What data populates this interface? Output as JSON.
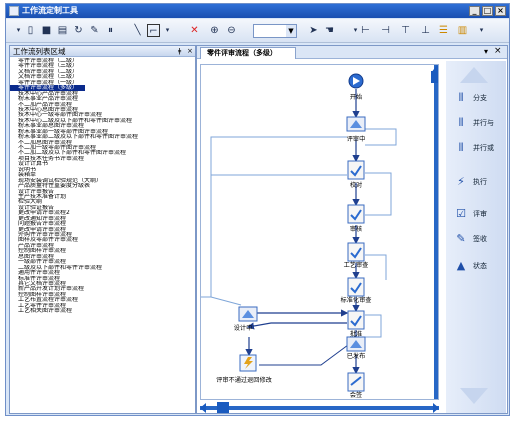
{
  "window": {
    "title": "工作流定制工具",
    "min": "_",
    "max": "□",
    "close": "×"
  },
  "left_panel": {
    "title": "工作流列表区域",
    "pin": "ǂ",
    "close": "×",
    "items": [
      "零件评审流程（二级）",
      "零件评审流程（三级）",
      "文档评审流程（二级）",
      "文档评审流程（三级）",
      "零件评审流程（一级）",
      "零件评审流程（多级）",
      "技术中心产品评审流程",
      "粉末事业产品评审流程",
      "不二加产品评审流程",
      "技术中心总图评审流程",
      "技术中心一级零部件图评审流程",
      "技术中心二级及以下部件和零件图评审流程",
      "粉末事业部总图评审流程",
      "粉末事业部一级零部件图评审流程",
      "粉末事业部二级及以下部件和零件图评审流程",
      "不二加总图评审流程",
      "不二加一级零部件图评审流程",
      "不二加二级及以下部件和零件图评审流程",
      "项目技术任务书评审流程",
      "设计计算书",
      "说明书",
      "装箱单",
      "现场安装调试检验规范（大纲）",
      "产品质量特性重要度分级表",
      "设计评审报告",
      "生产技术准备计划",
      "检验大纲",
      "设计验证报告",
      "更改申请评审流程2",
      "更改通知评审流程",
      "问题报告评审流程",
      "更改申请评审流程",
      "外购件评审评审流程",
      "图样及零部件评审流程",
      "产品评审流程",
      "控制图样评审流程",
      "总图评审流程",
      "一级部件评审流程",
      "二级及以下部件和零件评审流程",
      "通用件评审流程",
      "标准件评审流程",
      "其它文档评审流程",
      "新产品开发计划评审流程",
      "控制图样评审流程",
      "工艺布置流程评审流程",
      "工艺零件评审流程",
      "工艺相关图评审流程"
    ],
    "selected_index": 5
  },
  "tab": {
    "label": "零件评审流程（多级）",
    "menu": "▾",
    "close": "×"
  },
  "workflow": {
    "nodes": [
      "开始",
      "评审中",
      "校对",
      "审核",
      "工艺审查",
      "标准化审查",
      "批准",
      "设计中",
      "评审不通过退回修改",
      "已发布",
      "会签"
    ]
  },
  "tools": {
    "buttons": [
      "分支",
      "并行与",
      "并行或",
      "执行",
      "评审",
      "签收",
      "状态"
    ]
  },
  "toolbar": {
    "zoom_value": ""
  }
}
